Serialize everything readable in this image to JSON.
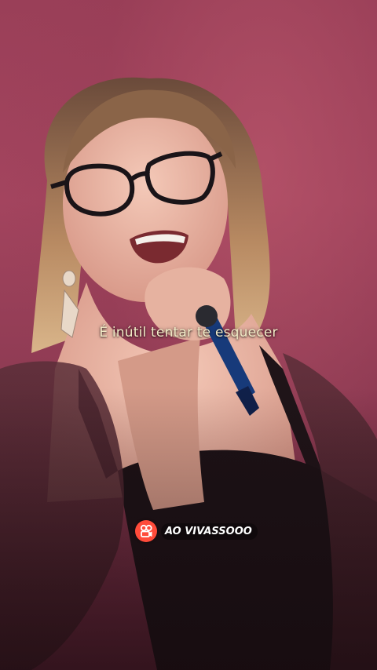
{
  "video": {
    "subtitle": "É inútil tentar te esquecer",
    "watermark_text": "AO VIVASSOOO",
    "watermark_icon": "kwai-logo-icon",
    "colors": {
      "background": "#9a3f58",
      "subtitle": "#f3ecc8",
      "watermark_logo": "#ff4b3a"
    }
  }
}
